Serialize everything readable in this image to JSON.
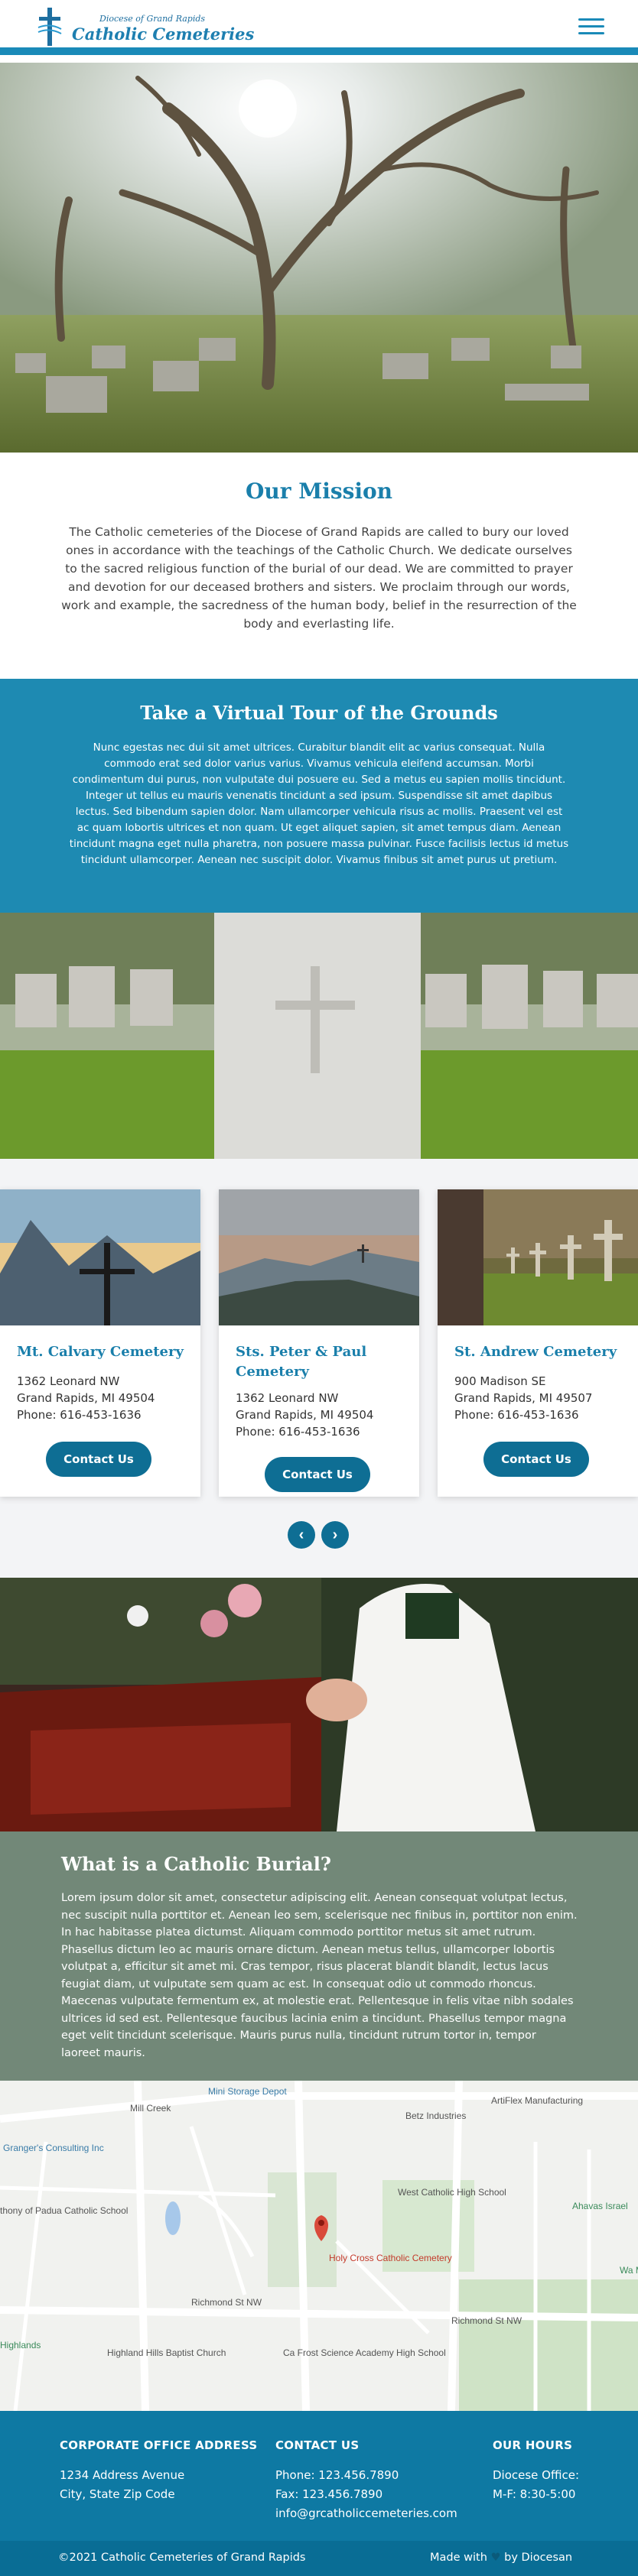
{
  "header": {
    "logo_small": "Diocese of Grand Rapids",
    "logo_big": "Catholic Cemeteries"
  },
  "mission": {
    "title": "Our Mission",
    "body": "The Catholic cemeteries of the Diocese of Grand Rapids are called to bury our loved ones in accordance with the teachings of the Catholic Church. We dedicate ourselves to the sacred religious function of the burial of our dead. We are committed to prayer and devotion for our deceased brothers and sisters. We proclaim through our words, work and example, the sacredness of the human body, belief in the resurrection of the body and everlasting life."
  },
  "tour": {
    "title": "Take a Virtual Tour of the Grounds",
    "body": "Nunc egestas nec dui sit amet ultrices. Curabitur blandit elit ac varius consequat. Nulla commodo erat sed dolor varius varius. Vivamus vehicula eleifend accumsan. Morbi condimentum dui purus, non vulputate dui posuere eu. Sed a metus eu sapien mollis tincidunt. Integer ut tellus eu mauris venenatis tincidunt a sed ipsum. Suspendisse sit amet dapibus lectus. Sed bibendum sapien dolor. Nam ullamcorper vehicula risus ac mollis. Praesent vel est ac quam lobortis ultrices et non quam. Ut eget aliquet sapien, sit amet tempus diam. Aenean tincidunt magna eget nulla pharetra, non posuere massa pulvinar. Fusce facilisis lectus id metus tincidunt ullamcorper. Aenean nec suscipit dolor. Vivamus finibus sit amet purus ut pretium."
  },
  "cemeteries": [
    {
      "name": "Mt. Calvary Cemetery",
      "street": "1362 Leonard NW",
      "city": "Grand Rapids, MI 49504",
      "phone": "Phone: 616-453-1636",
      "button": "Contact Us"
    },
    {
      "name": "Sts. Peter & Paul Cemetery",
      "street": "1362 Leonard NW",
      "city": "Grand Rapids, MI 49504",
      "phone": "Phone: 616-453-1636",
      "button": "Contact Us"
    },
    {
      "name": "St. Andrew Cemetery",
      "street": "900 Madison SE",
      "city": "Grand Rapids, MI 49507",
      "phone": "Phone: 616-453-1636",
      "button": "Contact Us"
    }
  ],
  "carousel": {
    "prev": "‹",
    "next": "›"
  },
  "burial": {
    "title": "What is a Catholic Burial?",
    "body": "Lorem ipsum dolor sit amet, consectetur adipiscing elit. Aenean consequat volutpat lectus, nec suscipit nulla porttitor et. Aenean leo sem, scelerisque nec finibus in, porttitor non enim. In hac habitasse platea dictumst. Aliquam commodo porttitor metus sit amet rutrum. Phasellus dictum leo ac mauris ornare dictum. Aenean metus tellus, ullamcorper lobortis volutpat a, efficitur sit amet mi. Cras tempor, risus placerat blandit blandit, lectus lacus feugiat diam, ut vulputate sem quam ac est. In consequat odio ut commodo rhoncus. Maecenas vulputate fermentum ex, at molestie erat. Pellentesque in felis vitae nibh sodales ultrices id sed est. Pellentesque faucibus lacinia enim a tincidunt. Phasellus tempor magna eget velit tincidunt scelerisque. Mauris purus nulla, tincidunt rutrum tortor in, tempor laoreet mauris."
  },
  "map": {
    "labels": [
      "Mini Storage Depot",
      "Betz Industries",
      "ArtiFlex Manufacturing",
      "Granger's Consulting Inc",
      "West Catholic High School",
      "Ahavas Israel",
      "thony of Padua Catholic School",
      "Holy Cross Catholic Cemetery",
      "Richmond St NW",
      "Richmond St NW",
      "Highland Hills Baptist Church",
      "Ca Frost Science Academy High School",
      "Highlands",
      "Mill Creek",
      "Wa Me"
    ],
    "pin_label": "Holy Cross Catholic Cemetery"
  },
  "footer": {
    "address_title": "CORPORATE OFFICE ADDRESS",
    "address_line1": "1234 Address Avenue",
    "address_line2": "City, State Zip Code",
    "contact_title": "CONTACT US",
    "phone": "Phone: 123.456.7890",
    "fax": "Fax: 123.456.7890",
    "email": "info@grcatholiccemeteries.com",
    "hours_title": "OUR HOURS",
    "hours_line1": "Diocese Office:",
    "hours_line2": "M-F: 8:30-5:00",
    "copyright": "©2021 Catholic Cemeteries of Grand Rapids",
    "made_with": "Made with",
    "made_by": "by Diocesan"
  },
  "colors": {
    "primary": "#1a8ab8",
    "dark": "#0e6e94",
    "burial_bg": "#728878"
  }
}
